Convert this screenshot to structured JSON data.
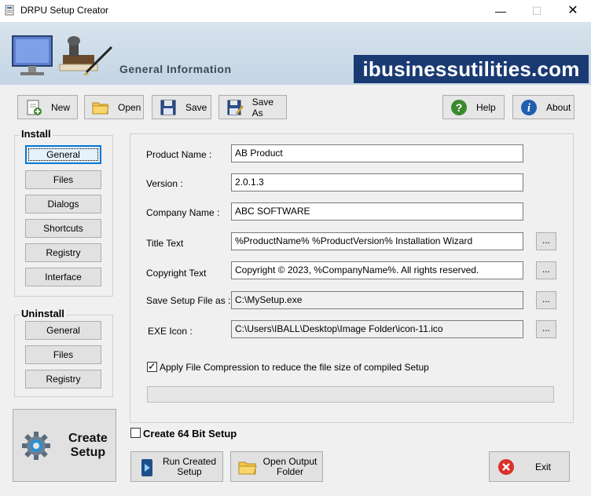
{
  "window": {
    "title": "DRPU Setup Creator",
    "minimize": "—",
    "maximize": "☐",
    "close": "✕"
  },
  "banner": {
    "title": "General Information",
    "brand": "ibusinessutilities.com"
  },
  "toolbar": {
    "new_label": "New",
    "open_label": "Open",
    "save_label": "Save",
    "save_as_label": "Save As",
    "help_label": "Help",
    "about_label": "About"
  },
  "install": {
    "label": "Install",
    "items": [
      "General",
      "Files",
      "Dialogs",
      "Shortcuts",
      "Registry",
      "Interface"
    ]
  },
  "uninstall": {
    "label": "Uninstall",
    "items": [
      "General",
      "Files",
      "Registry"
    ]
  },
  "form": {
    "product_name_label": "Product Name :",
    "product_name_value": "AB Product",
    "version_label": "Version :",
    "version_value": "2.0.1.3",
    "company_name_label": "Company Name :",
    "company_name_value": "ABC SOFTWARE",
    "title_text_label": "Title Text",
    "title_text_value": "%ProductName% %ProductVersion% Installation Wizard",
    "copyright_label": "Copyright Text",
    "copyright_value": "Copyright © 2023, %CompanyName%. All rights reserved.",
    "save_setup_label": "Save Setup File as :",
    "save_setup_value": "C:\\MySetup.exe",
    "exe_icon_label": "EXE Icon :",
    "exe_icon_value": "C:\\Users\\IBALL\\Desktop\\Image Folder\\icon-11.ico",
    "browse_label": "...",
    "compression_label": "Apply File Compression to reduce the file size of compiled Setup",
    "compression_checked": true,
    "progress": 0
  },
  "bottom": {
    "create_64_label": "Create 64 Bit Setup",
    "create_64_checked": false,
    "create_setup_line1": "Create",
    "create_setup_line2": "Setup",
    "run_line1": "Run Created",
    "run_line2": "Setup",
    "open_output_line1": "Open Output",
    "open_output_line2": "Folder",
    "exit_label": "Exit"
  },
  "colors": {
    "brand_bg": "#1a3a74",
    "banner_bg": "#c3d4e3",
    "focus": "#0078d7",
    "exit_red": "#d9302c",
    "help_green": "#3c8a2e",
    "about_blue": "#1f5fb0"
  }
}
